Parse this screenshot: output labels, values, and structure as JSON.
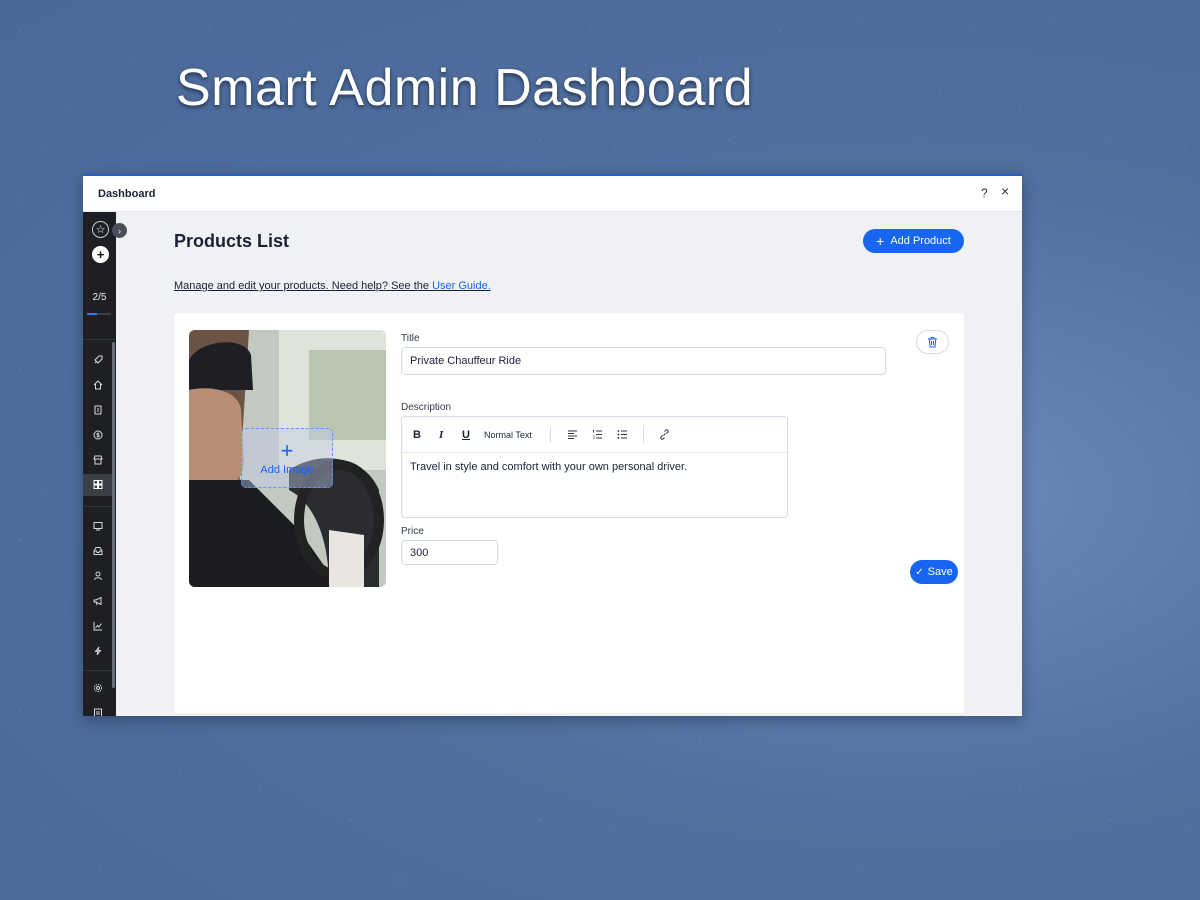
{
  "hero": {
    "title": "Smart Admin Dashboard"
  },
  "window": {
    "title": "Dashboard",
    "help_label": "?",
    "close_label": "×"
  },
  "sidebar": {
    "progress_label": "2/5",
    "progress_fraction": 0.4,
    "icons": [
      "rocket-icon",
      "home-icon",
      "invoice-icon",
      "dollar-icon",
      "store-icon",
      "apps-icon",
      "website-icon",
      "inbox-icon",
      "contacts-icon",
      "megaphone-icon",
      "analytics-icon",
      "automation-icon",
      "settings-icon",
      "list-icon"
    ],
    "active_icon": "apps-icon"
  },
  "main": {
    "page_title": "Products List",
    "add_product_label": "Add Product",
    "help_text_prefix": "Manage and edit your products. Need help? See the ",
    "help_link": "User Guide.",
    "product": {
      "title_label": "Title",
      "title_value": "Private Chauffeur Ride",
      "description_label": "Description",
      "description_value": "Travel in style and comfort with your own personal driver.",
      "price_label": "Price",
      "price_value": "300",
      "add_image_label": "Add Image",
      "save_label": "Save"
    },
    "editor_toolbar": {
      "bold": "B",
      "italic": "I",
      "underline": "U",
      "text_style": "Normal Text"
    }
  },
  "colors": {
    "accent": "#1765f0",
    "sidebar_bg": "#1d1f24",
    "window_top_border": "#1f5fd6"
  }
}
